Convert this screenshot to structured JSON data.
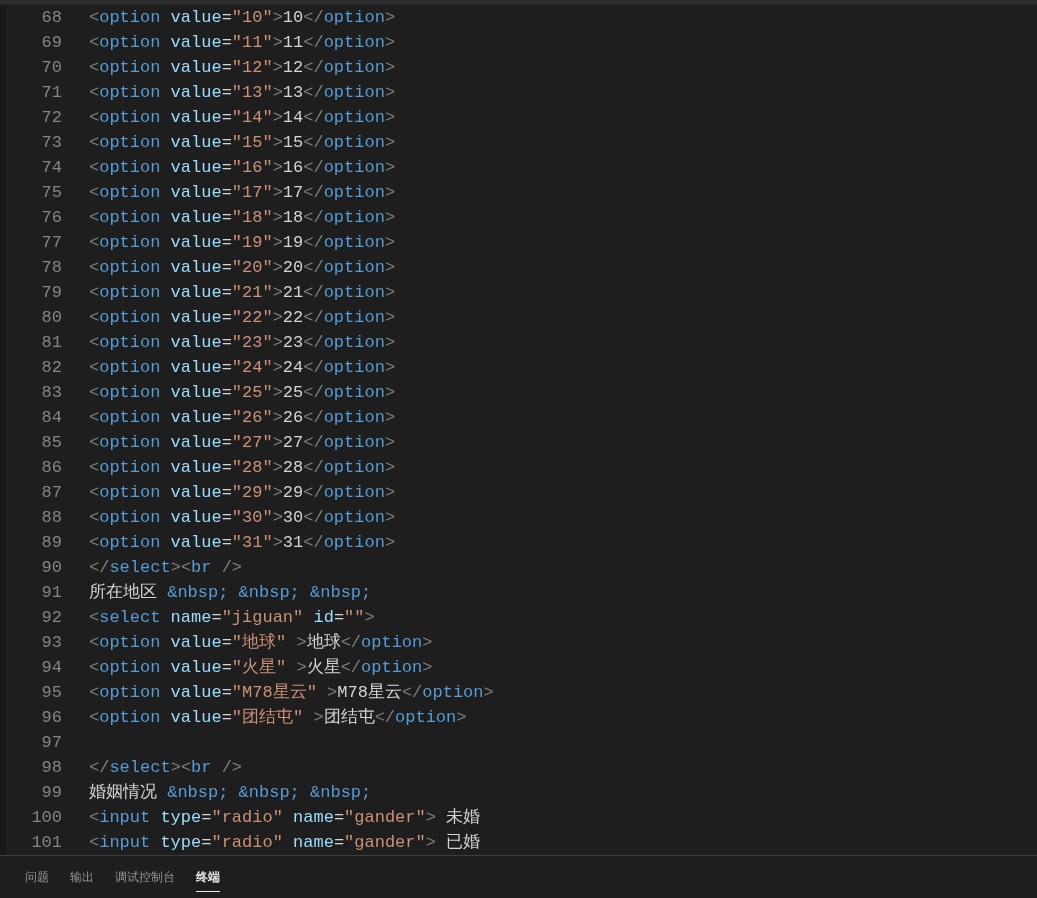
{
  "editor": {
    "lines": [
      {
        "number": "68",
        "tokens": [
          {
            "kind": "punct",
            "text": "<"
          },
          {
            "kind": "tag",
            "text": "option"
          },
          {
            "kind": "attr",
            "text": " value"
          },
          {
            "kind": "text",
            "text": "="
          },
          {
            "kind": "string",
            "text": "\"10\""
          },
          {
            "kind": "punct",
            "text": ">"
          },
          {
            "kind": "text",
            "text": "10"
          },
          {
            "kind": "punct",
            "text": "</"
          },
          {
            "kind": "tag",
            "text": "option"
          },
          {
            "kind": "punct",
            "text": ">"
          }
        ]
      },
      {
        "number": "69",
        "tokens": [
          {
            "kind": "punct",
            "text": "<"
          },
          {
            "kind": "tag",
            "text": "option"
          },
          {
            "kind": "attr",
            "text": " value"
          },
          {
            "kind": "text",
            "text": "="
          },
          {
            "kind": "string",
            "text": "\"11\""
          },
          {
            "kind": "punct",
            "text": ">"
          },
          {
            "kind": "text",
            "text": "11"
          },
          {
            "kind": "punct",
            "text": "</"
          },
          {
            "kind": "tag",
            "text": "option"
          },
          {
            "kind": "punct",
            "text": ">"
          }
        ]
      },
      {
        "number": "70",
        "tokens": [
          {
            "kind": "punct",
            "text": "<"
          },
          {
            "kind": "tag",
            "text": "option"
          },
          {
            "kind": "attr",
            "text": " value"
          },
          {
            "kind": "text",
            "text": "="
          },
          {
            "kind": "string",
            "text": "\"12\""
          },
          {
            "kind": "punct",
            "text": ">"
          },
          {
            "kind": "text",
            "text": "12"
          },
          {
            "kind": "punct",
            "text": "</"
          },
          {
            "kind": "tag",
            "text": "option"
          },
          {
            "kind": "punct",
            "text": ">"
          }
        ]
      },
      {
        "number": "71",
        "tokens": [
          {
            "kind": "punct",
            "text": "<"
          },
          {
            "kind": "tag",
            "text": "option"
          },
          {
            "kind": "attr",
            "text": " value"
          },
          {
            "kind": "text",
            "text": "="
          },
          {
            "kind": "string",
            "text": "\"13\""
          },
          {
            "kind": "punct",
            "text": ">"
          },
          {
            "kind": "text",
            "text": "13"
          },
          {
            "kind": "punct",
            "text": "</"
          },
          {
            "kind": "tag",
            "text": "option"
          },
          {
            "kind": "punct",
            "text": ">"
          }
        ]
      },
      {
        "number": "72",
        "tokens": [
          {
            "kind": "punct",
            "text": "<"
          },
          {
            "kind": "tag",
            "text": "option"
          },
          {
            "kind": "attr",
            "text": " value"
          },
          {
            "kind": "text",
            "text": "="
          },
          {
            "kind": "string",
            "text": "\"14\""
          },
          {
            "kind": "punct",
            "text": ">"
          },
          {
            "kind": "text",
            "text": "14"
          },
          {
            "kind": "punct",
            "text": "</"
          },
          {
            "kind": "tag",
            "text": "option"
          },
          {
            "kind": "punct",
            "text": ">"
          }
        ]
      },
      {
        "number": "73",
        "tokens": [
          {
            "kind": "punct",
            "text": "<"
          },
          {
            "kind": "tag",
            "text": "option"
          },
          {
            "kind": "attr",
            "text": " value"
          },
          {
            "kind": "text",
            "text": "="
          },
          {
            "kind": "string",
            "text": "\"15\""
          },
          {
            "kind": "punct",
            "text": ">"
          },
          {
            "kind": "text",
            "text": "15"
          },
          {
            "kind": "punct",
            "text": "</"
          },
          {
            "kind": "tag",
            "text": "option"
          },
          {
            "kind": "punct",
            "text": ">"
          }
        ]
      },
      {
        "number": "74",
        "tokens": [
          {
            "kind": "punct",
            "text": "<"
          },
          {
            "kind": "tag",
            "text": "option"
          },
          {
            "kind": "attr",
            "text": " value"
          },
          {
            "kind": "text",
            "text": "="
          },
          {
            "kind": "string",
            "text": "\"16\""
          },
          {
            "kind": "punct",
            "text": ">"
          },
          {
            "kind": "text",
            "text": "16"
          },
          {
            "kind": "punct",
            "text": "</"
          },
          {
            "kind": "tag",
            "text": "option"
          },
          {
            "kind": "punct",
            "text": ">"
          }
        ]
      },
      {
        "number": "75",
        "tokens": [
          {
            "kind": "punct",
            "text": "<"
          },
          {
            "kind": "tag",
            "text": "option"
          },
          {
            "kind": "attr",
            "text": " value"
          },
          {
            "kind": "text",
            "text": "="
          },
          {
            "kind": "string",
            "text": "\"17\""
          },
          {
            "kind": "punct",
            "text": ">"
          },
          {
            "kind": "text",
            "text": "17"
          },
          {
            "kind": "punct",
            "text": "</"
          },
          {
            "kind": "tag",
            "text": "option"
          },
          {
            "kind": "punct",
            "text": ">"
          }
        ]
      },
      {
        "number": "76",
        "tokens": [
          {
            "kind": "punct",
            "text": "<"
          },
          {
            "kind": "tag",
            "text": "option"
          },
          {
            "kind": "attr",
            "text": " value"
          },
          {
            "kind": "text",
            "text": "="
          },
          {
            "kind": "string",
            "text": "\"18\""
          },
          {
            "kind": "punct",
            "text": ">"
          },
          {
            "kind": "text",
            "text": "18"
          },
          {
            "kind": "punct",
            "text": "</"
          },
          {
            "kind": "tag",
            "text": "option"
          },
          {
            "kind": "punct",
            "text": ">"
          }
        ]
      },
      {
        "number": "77",
        "tokens": [
          {
            "kind": "punct",
            "text": "<"
          },
          {
            "kind": "tag",
            "text": "option"
          },
          {
            "kind": "attr",
            "text": " value"
          },
          {
            "kind": "text",
            "text": "="
          },
          {
            "kind": "string",
            "text": "\"19\""
          },
          {
            "kind": "punct",
            "text": ">"
          },
          {
            "kind": "text",
            "text": "19"
          },
          {
            "kind": "punct",
            "text": "</"
          },
          {
            "kind": "tag",
            "text": "option"
          },
          {
            "kind": "punct",
            "text": ">"
          }
        ]
      },
      {
        "number": "78",
        "tokens": [
          {
            "kind": "punct",
            "text": "<"
          },
          {
            "kind": "tag",
            "text": "option"
          },
          {
            "kind": "attr",
            "text": " value"
          },
          {
            "kind": "text",
            "text": "="
          },
          {
            "kind": "string",
            "text": "\"20\""
          },
          {
            "kind": "punct",
            "text": ">"
          },
          {
            "kind": "text",
            "text": "20"
          },
          {
            "kind": "punct",
            "text": "</"
          },
          {
            "kind": "tag",
            "text": "option"
          },
          {
            "kind": "punct",
            "text": ">"
          }
        ]
      },
      {
        "number": "79",
        "tokens": [
          {
            "kind": "punct",
            "text": "<"
          },
          {
            "kind": "tag",
            "text": "option"
          },
          {
            "kind": "attr",
            "text": " value"
          },
          {
            "kind": "text",
            "text": "="
          },
          {
            "kind": "string",
            "text": "\"21\""
          },
          {
            "kind": "punct",
            "text": ">"
          },
          {
            "kind": "text",
            "text": "21"
          },
          {
            "kind": "punct",
            "text": "</"
          },
          {
            "kind": "tag",
            "text": "option"
          },
          {
            "kind": "punct",
            "text": ">"
          }
        ]
      },
      {
        "number": "80",
        "tokens": [
          {
            "kind": "punct",
            "text": "<"
          },
          {
            "kind": "tag",
            "text": "option"
          },
          {
            "kind": "attr",
            "text": " value"
          },
          {
            "kind": "text",
            "text": "="
          },
          {
            "kind": "string",
            "text": "\"22\""
          },
          {
            "kind": "punct",
            "text": ">"
          },
          {
            "kind": "text",
            "text": "22"
          },
          {
            "kind": "punct",
            "text": "</"
          },
          {
            "kind": "tag",
            "text": "option"
          },
          {
            "kind": "punct",
            "text": ">"
          }
        ]
      },
      {
        "number": "81",
        "tokens": [
          {
            "kind": "punct",
            "text": "<"
          },
          {
            "kind": "tag",
            "text": "option"
          },
          {
            "kind": "attr",
            "text": " value"
          },
          {
            "kind": "text",
            "text": "="
          },
          {
            "kind": "string",
            "text": "\"23\""
          },
          {
            "kind": "punct",
            "text": ">"
          },
          {
            "kind": "text",
            "text": "23"
          },
          {
            "kind": "punct",
            "text": "</"
          },
          {
            "kind": "tag",
            "text": "option"
          },
          {
            "kind": "punct",
            "text": ">"
          }
        ]
      },
      {
        "number": "82",
        "tokens": [
          {
            "kind": "punct",
            "text": "<"
          },
          {
            "kind": "tag",
            "text": "option"
          },
          {
            "kind": "attr",
            "text": " value"
          },
          {
            "kind": "text",
            "text": "="
          },
          {
            "kind": "string",
            "text": "\"24\""
          },
          {
            "kind": "punct",
            "text": ">"
          },
          {
            "kind": "text",
            "text": "24"
          },
          {
            "kind": "punct",
            "text": "</"
          },
          {
            "kind": "tag",
            "text": "option"
          },
          {
            "kind": "punct",
            "text": ">"
          }
        ]
      },
      {
        "number": "83",
        "tokens": [
          {
            "kind": "punct",
            "text": "<"
          },
          {
            "kind": "tag",
            "text": "option"
          },
          {
            "kind": "attr",
            "text": " value"
          },
          {
            "kind": "text",
            "text": "="
          },
          {
            "kind": "string",
            "text": "\"25\""
          },
          {
            "kind": "punct",
            "text": ">"
          },
          {
            "kind": "text",
            "text": "25"
          },
          {
            "kind": "punct",
            "text": "</"
          },
          {
            "kind": "tag",
            "text": "option"
          },
          {
            "kind": "punct",
            "text": ">"
          }
        ]
      },
      {
        "number": "84",
        "tokens": [
          {
            "kind": "punct",
            "text": "<"
          },
          {
            "kind": "tag",
            "text": "option"
          },
          {
            "kind": "attr",
            "text": " value"
          },
          {
            "kind": "text",
            "text": "="
          },
          {
            "kind": "string",
            "text": "\"26\""
          },
          {
            "kind": "punct",
            "text": ">"
          },
          {
            "kind": "text",
            "text": "26"
          },
          {
            "kind": "punct",
            "text": "</"
          },
          {
            "kind": "tag",
            "text": "option"
          },
          {
            "kind": "punct",
            "text": ">"
          }
        ]
      },
      {
        "number": "85",
        "tokens": [
          {
            "kind": "punct",
            "text": "<"
          },
          {
            "kind": "tag",
            "text": "option"
          },
          {
            "kind": "attr",
            "text": " value"
          },
          {
            "kind": "text",
            "text": "="
          },
          {
            "kind": "string",
            "text": "\"27\""
          },
          {
            "kind": "punct",
            "text": ">"
          },
          {
            "kind": "text",
            "text": "27"
          },
          {
            "kind": "punct",
            "text": "</"
          },
          {
            "kind": "tag",
            "text": "option"
          },
          {
            "kind": "punct",
            "text": ">"
          }
        ]
      },
      {
        "number": "86",
        "tokens": [
          {
            "kind": "punct",
            "text": "<"
          },
          {
            "kind": "tag",
            "text": "option"
          },
          {
            "kind": "attr",
            "text": " value"
          },
          {
            "kind": "text",
            "text": "="
          },
          {
            "kind": "string",
            "text": "\"28\""
          },
          {
            "kind": "punct",
            "text": ">"
          },
          {
            "kind": "text",
            "text": "28"
          },
          {
            "kind": "punct",
            "text": "</"
          },
          {
            "kind": "tag",
            "text": "option"
          },
          {
            "kind": "punct",
            "text": ">"
          }
        ]
      },
      {
        "number": "87",
        "tokens": [
          {
            "kind": "punct",
            "text": "<"
          },
          {
            "kind": "tag",
            "text": "option"
          },
          {
            "kind": "attr",
            "text": " value"
          },
          {
            "kind": "text",
            "text": "="
          },
          {
            "kind": "string",
            "text": "\"29\""
          },
          {
            "kind": "punct",
            "text": ">"
          },
          {
            "kind": "text",
            "text": "29"
          },
          {
            "kind": "punct",
            "text": "</"
          },
          {
            "kind": "tag",
            "text": "option"
          },
          {
            "kind": "punct",
            "text": ">"
          }
        ]
      },
      {
        "number": "88",
        "tokens": [
          {
            "kind": "punct",
            "text": "<"
          },
          {
            "kind": "tag",
            "text": "option"
          },
          {
            "kind": "attr",
            "text": " value"
          },
          {
            "kind": "text",
            "text": "="
          },
          {
            "kind": "string",
            "text": "\"30\""
          },
          {
            "kind": "punct",
            "text": ">"
          },
          {
            "kind": "text",
            "text": "30"
          },
          {
            "kind": "punct",
            "text": "</"
          },
          {
            "kind": "tag",
            "text": "option"
          },
          {
            "kind": "punct",
            "text": ">"
          }
        ]
      },
      {
        "number": "89",
        "tokens": [
          {
            "kind": "punct",
            "text": "<"
          },
          {
            "kind": "tag",
            "text": "option"
          },
          {
            "kind": "attr",
            "text": " value"
          },
          {
            "kind": "text",
            "text": "="
          },
          {
            "kind": "string",
            "text": "\"31\""
          },
          {
            "kind": "punct",
            "text": ">"
          },
          {
            "kind": "text",
            "text": "31"
          },
          {
            "kind": "punct",
            "text": "</"
          },
          {
            "kind": "tag",
            "text": "option"
          },
          {
            "kind": "punct",
            "text": ">"
          }
        ]
      },
      {
        "number": "90",
        "tokens": [
          {
            "kind": "punct",
            "text": "</"
          },
          {
            "kind": "tag",
            "text": "select"
          },
          {
            "kind": "punct",
            "text": "><"
          },
          {
            "kind": "tag",
            "text": "br"
          },
          {
            "kind": "punct",
            "text": " />"
          }
        ]
      },
      {
        "number": "91",
        "tokens": [
          {
            "kind": "text",
            "text": "所在地区"
          },
          {
            "kind": "entity",
            "text": " &nbsp; &nbsp; &nbsp;"
          }
        ]
      },
      {
        "number": "92",
        "tokens": [
          {
            "kind": "punct",
            "text": "<"
          },
          {
            "kind": "tag",
            "text": "select"
          },
          {
            "kind": "attr",
            "text": " name"
          },
          {
            "kind": "text",
            "text": "="
          },
          {
            "kind": "string",
            "text": "\"jiguan\""
          },
          {
            "kind": "attr",
            "text": " id"
          },
          {
            "kind": "text",
            "text": "="
          },
          {
            "kind": "string",
            "text": "\"\""
          },
          {
            "kind": "punct",
            "text": ">"
          }
        ]
      },
      {
        "number": "93",
        "tokens": [
          {
            "kind": "punct",
            "text": "<"
          },
          {
            "kind": "tag",
            "text": "option"
          },
          {
            "kind": "attr",
            "text": " value"
          },
          {
            "kind": "text",
            "text": "="
          },
          {
            "kind": "string",
            "text": "\"地球\""
          },
          {
            "kind": "punct",
            "text": " >"
          },
          {
            "kind": "text",
            "text": "地球"
          },
          {
            "kind": "punct",
            "text": "</"
          },
          {
            "kind": "tag",
            "text": "option"
          },
          {
            "kind": "punct",
            "text": ">"
          }
        ]
      },
      {
        "number": "94",
        "tokens": [
          {
            "kind": "punct",
            "text": "<"
          },
          {
            "kind": "tag",
            "text": "option"
          },
          {
            "kind": "attr",
            "text": " value"
          },
          {
            "kind": "text",
            "text": "="
          },
          {
            "kind": "string",
            "text": "\"火星\""
          },
          {
            "kind": "punct",
            "text": " >"
          },
          {
            "kind": "text",
            "text": "火星"
          },
          {
            "kind": "punct",
            "text": "</"
          },
          {
            "kind": "tag",
            "text": "option"
          },
          {
            "kind": "punct",
            "text": ">"
          }
        ]
      },
      {
        "number": "95",
        "tokens": [
          {
            "kind": "punct",
            "text": "<"
          },
          {
            "kind": "tag",
            "text": "option"
          },
          {
            "kind": "attr",
            "text": " value"
          },
          {
            "kind": "text",
            "text": "="
          },
          {
            "kind": "string",
            "text": "\"M78星云\""
          },
          {
            "kind": "punct",
            "text": " >"
          },
          {
            "kind": "text",
            "text": "M78星云"
          },
          {
            "kind": "punct",
            "text": "</"
          },
          {
            "kind": "tag",
            "text": "option"
          },
          {
            "kind": "punct",
            "text": ">"
          }
        ]
      },
      {
        "number": "96",
        "tokens": [
          {
            "kind": "punct",
            "text": "<"
          },
          {
            "kind": "tag",
            "text": "option"
          },
          {
            "kind": "attr",
            "text": " value"
          },
          {
            "kind": "text",
            "text": "="
          },
          {
            "kind": "string",
            "text": "\"团结屯\""
          },
          {
            "kind": "punct",
            "text": " >"
          },
          {
            "kind": "text",
            "text": "团结屯"
          },
          {
            "kind": "punct",
            "text": "</"
          },
          {
            "kind": "tag",
            "text": "option"
          },
          {
            "kind": "punct",
            "text": ">"
          }
        ]
      },
      {
        "number": "97"
      },
      {
        "number": "98",
        "tokens": [
          {
            "kind": "punct",
            "text": "</"
          },
          {
            "kind": "tag",
            "text": "select"
          },
          {
            "kind": "punct",
            "text": "><"
          },
          {
            "kind": "tag",
            "text": "br"
          },
          {
            "kind": "punct",
            "text": " />"
          }
        ]
      },
      {
        "number": "99",
        "tokens": [
          {
            "kind": "text",
            "text": "婚姻情况"
          },
          {
            "kind": "entity",
            "text": " &nbsp; &nbsp; &nbsp;"
          }
        ]
      },
      {
        "number": "100",
        "tokens": [
          {
            "kind": "punct",
            "text": "<"
          },
          {
            "kind": "tag",
            "text": "input"
          },
          {
            "kind": "attr",
            "text": " type"
          },
          {
            "kind": "text",
            "text": "="
          },
          {
            "kind": "string",
            "text": "\"radio\""
          },
          {
            "kind": "attr",
            "text": " name"
          },
          {
            "kind": "text",
            "text": "="
          },
          {
            "kind": "string",
            "text": "\"gander\""
          },
          {
            "kind": "punct",
            "text": ">"
          },
          {
            "kind": "text",
            "text": " 未婚"
          }
        ]
      },
      {
        "number": "101",
        "tokens": [
          {
            "kind": "punct",
            "text": "<"
          },
          {
            "kind": "tag",
            "text": "input"
          },
          {
            "kind": "attr",
            "text": " type"
          },
          {
            "kind": "text",
            "text": "="
          },
          {
            "kind": "string",
            "text": "\"radio\""
          },
          {
            "kind": "attr",
            "text": " name"
          },
          {
            "kind": "text",
            "text": "="
          },
          {
            "kind": "string",
            "text": "\"gander\""
          },
          {
            "kind": "punct",
            "text": ">"
          },
          {
            "kind": "text",
            "text": " 已婚"
          }
        ]
      }
    ]
  },
  "panel_tabs": [
    {
      "label": "问题",
      "selected": false
    },
    {
      "label": "输出",
      "selected": false
    },
    {
      "label": "调试控制台",
      "selected": false
    },
    {
      "label": "终端",
      "selected": true
    }
  ]
}
